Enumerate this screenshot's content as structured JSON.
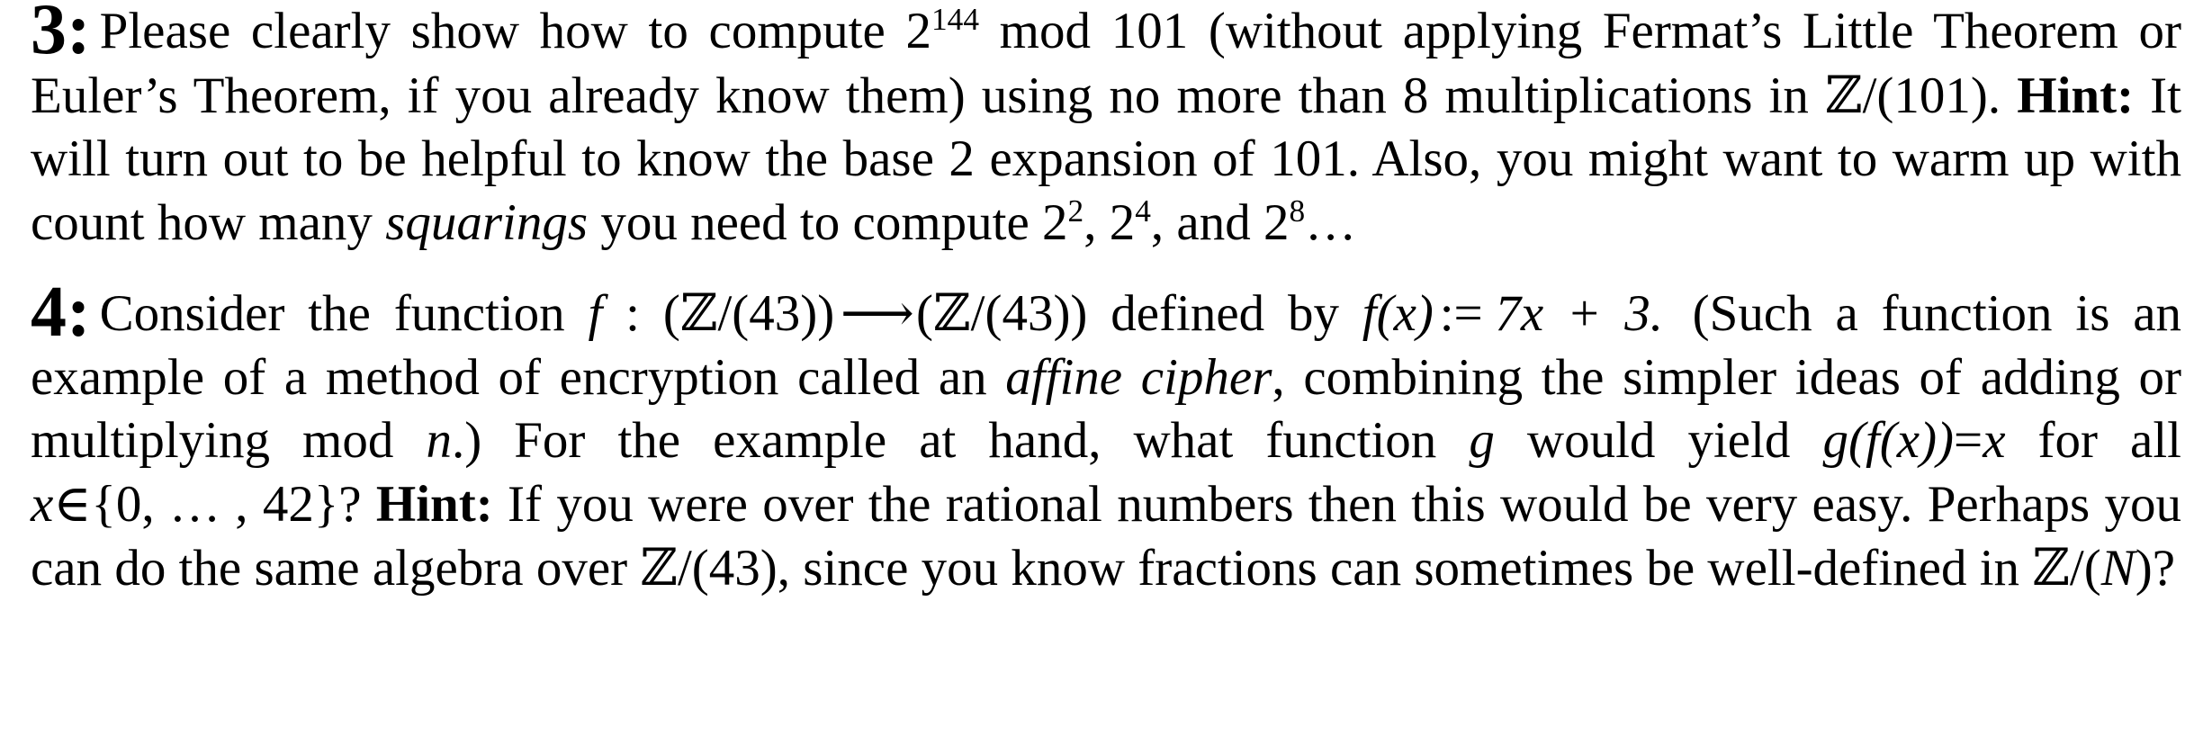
{
  "document": {
    "type": "math-homework-problems",
    "font_style": "serif-latex",
    "background_color": "#ffffff",
    "text_color": "#000000"
  },
  "problems": [
    {
      "number": "3:",
      "parts": {
        "p1": "Please clearly show how to compute 2",
        "exp1": "144",
        "p2": " mod 101 (without applying Fermat’s Little Theorem or Euler’s Theorem, if you already know them) using no more than 8 multiplications in ",
        "set1": "ℤ",
        "set1_tail": "/(101). ",
        "hint_label": "Hint:",
        "p3": " It will turn out to be helpful to know the base 2 expansion of 101. Also, you might want to warm up with count how many ",
        "italic1": "squarings",
        "p4": " you need to compute 2",
        "exp2": "2",
        "p5": ", 2",
        "exp3": "4",
        "p6": ", and 2",
        "exp4": "8",
        "p7": "…"
      }
    },
    {
      "number": "4:",
      "parts": {
        "p1": "Consider the function ",
        "f1": "f",
        "colon": " : ",
        "dom_open": "(",
        "dom_z": "ℤ",
        "dom_rest": "/(43))",
        "arrow": "⟶",
        "cod_open": "(",
        "cod_z": "ℤ",
        "cod_rest": "/(43))",
        "p2": " defined by ",
        "f2": "f",
        "f2_arg": "(x)",
        "assign": ":=",
        "rhs": "7x + 3.",
        "p3": " (Such a function is an example of a method of encryption called an ",
        "italic1": "affine cipher",
        "p4": ", combining the simpler ideas of adding or multiplying mod ",
        "var_n": "n",
        "p5": ".) For the example at hand, what function ",
        "var_g": "g",
        "p6": " would yield ",
        "eq_g": "g",
        "eq_fx": "(f(x))",
        "eq_sign": "=",
        "eq_x": "x",
        "p7": " for all ",
        "member_x": "x",
        "member_in": "∈",
        "member_set": "{0, … , 42}?",
        "hint_label": "Hint:",
        "p8": " If you were over the rational numbers then this would be very easy. Perhaps you can do the same algebra over ",
        "set_z2": "ℤ",
        "set_z2_rest": "/(43)",
        "p9": ", since you know fractions can sometimes be well-defined in ",
        "set_z3": "ℤ",
        "set_z3_open": "/(",
        "set_z3_var": "N",
        "set_z3_close": ")?"
      }
    }
  ]
}
